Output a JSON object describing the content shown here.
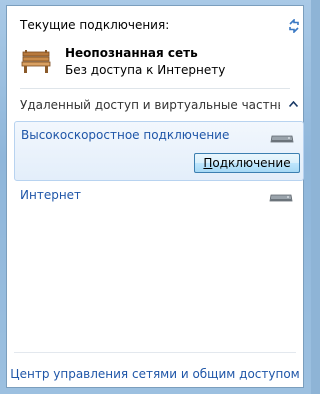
{
  "header": {
    "title": "Текущие подключения:",
    "refresh_icon": "refresh-icon"
  },
  "current_network": {
    "name": "Неопознанная сеть",
    "status": "Без доступа к Интернету",
    "icon": "bench-network-icon"
  },
  "section": {
    "title": "Удаленный доступ и виртуальные частные се...",
    "icon": "chevron-up-icon"
  },
  "connections": [
    {
      "label": "Высокоскоростное подключение",
      "icon": "modem-icon",
      "selected": true,
      "button_prefix": "",
      "button_key": "П",
      "button_rest": "одключение"
    },
    {
      "label": "Интернет",
      "icon": "modem-icon",
      "selected": false
    }
  ],
  "footer": {
    "link": "Центр управления сетями и общим доступом"
  },
  "colors": {
    "link": "#1f56a8",
    "selection_bg": "#e3eefa",
    "selection_border": "#b8d3f0"
  }
}
